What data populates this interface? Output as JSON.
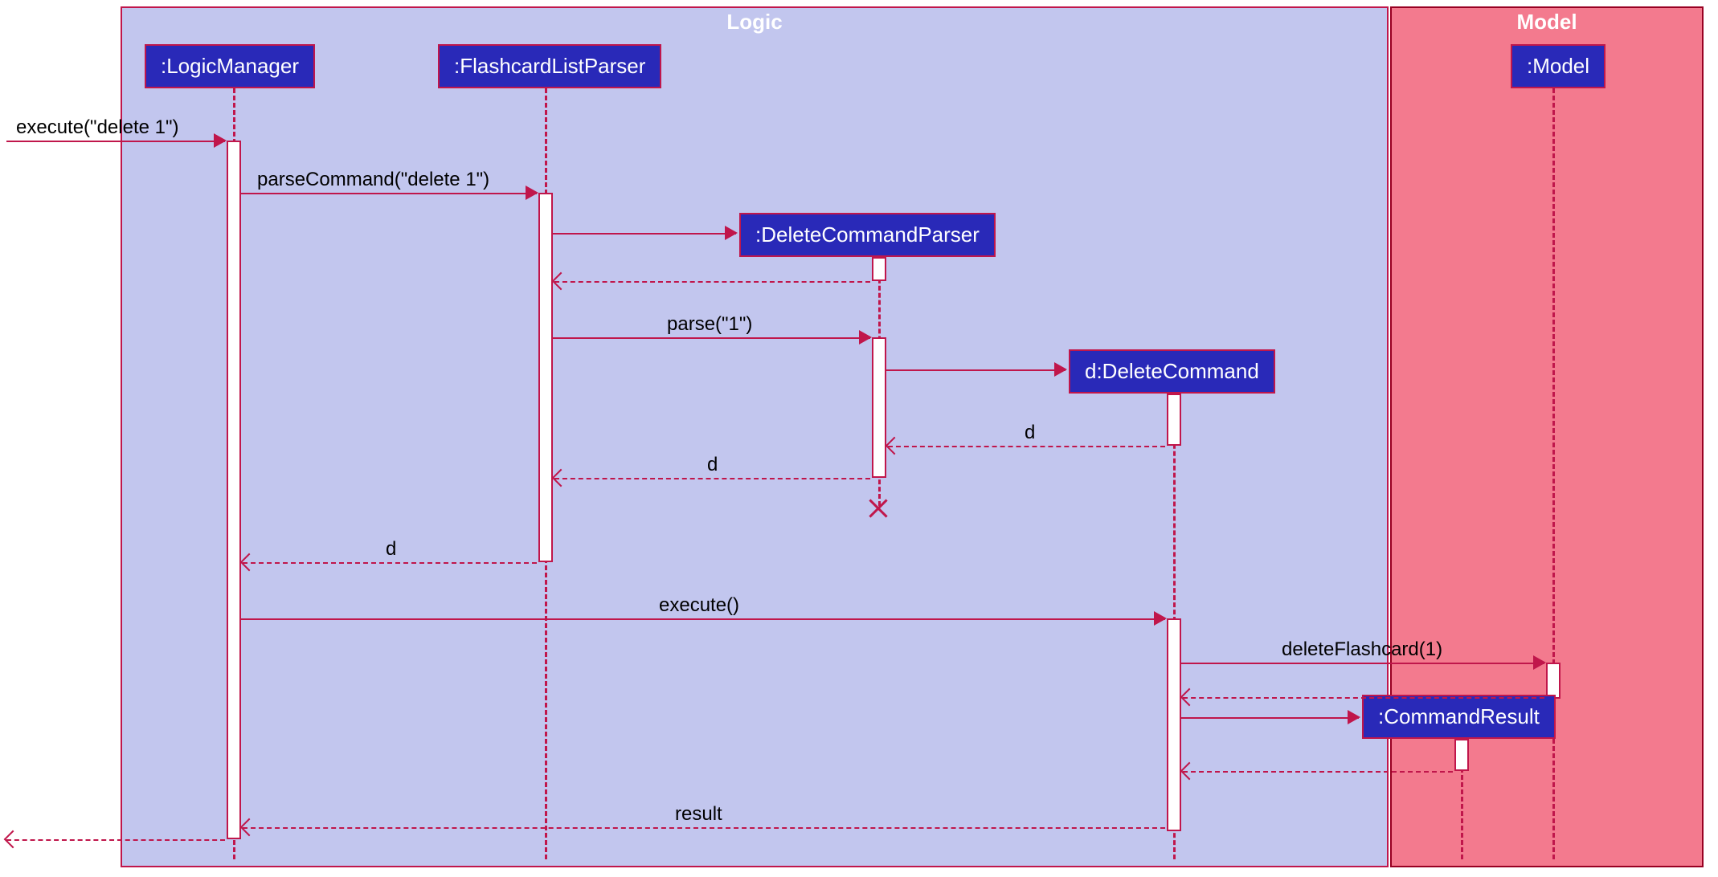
{
  "frames": {
    "logic": "Logic",
    "model": "Model"
  },
  "participants": {
    "logicManager": ":LogicManager",
    "flashcardListParser": ":FlashcardListParser",
    "deleteCommandParser": ":DeleteCommandParser",
    "deleteCommand": "d:DeleteCommand",
    "commandResult": ":CommandResult",
    "model": ":Model"
  },
  "messages": {
    "execute_in": "execute(\"delete 1\")",
    "parseCommand": "parseCommand(\"delete 1\")",
    "parse": "parse(\"1\")",
    "d": "d",
    "execute": "execute()",
    "deleteFlashcard": "deleteFlashcard(1)",
    "result": "result"
  },
  "colors": {
    "logic_bg": "#c2c6ee",
    "model_bg": "#f37a8e",
    "border": "#c0164b",
    "participant": "#2929b8"
  }
}
